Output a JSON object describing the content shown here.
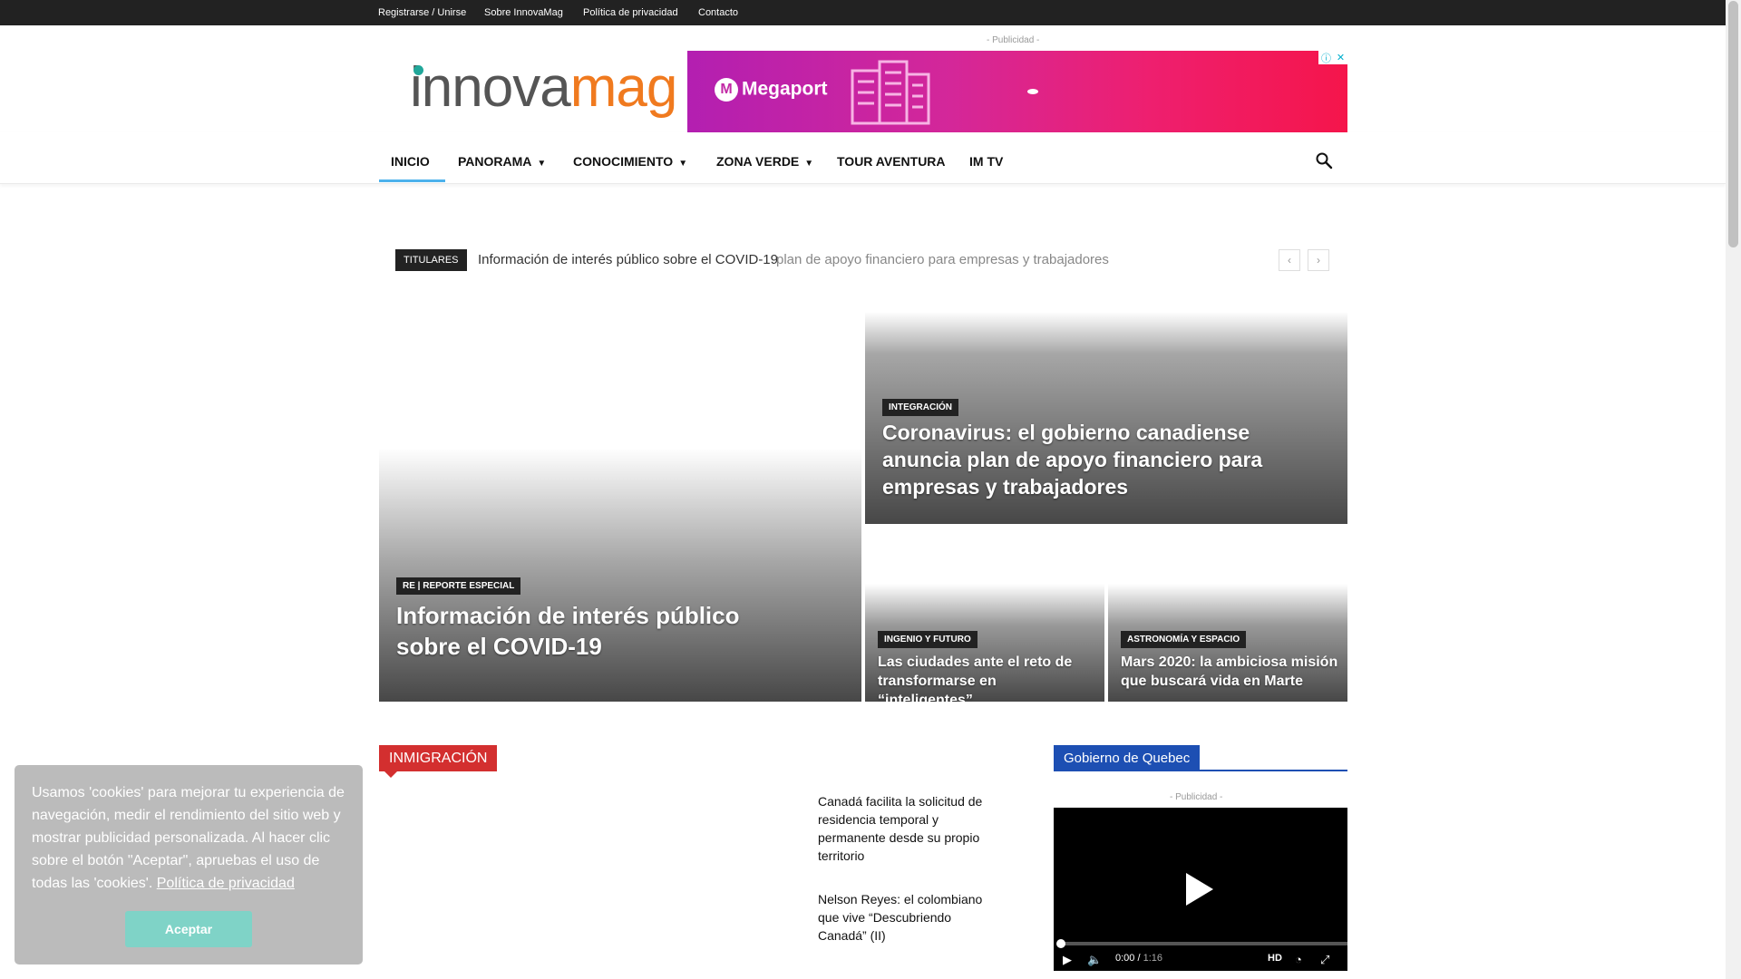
{
  "topbar": {
    "links": [
      "Registrarse / Unirse",
      "Sobre InnovaMag",
      "Política de privacidad",
      "Contacto"
    ]
  },
  "header": {
    "logo_text_a": "innova",
    "logo_text_b": "mag",
    "ad_label": "- Publicidad -",
    "banner_brand": "Megaport"
  },
  "nav": {
    "items": [
      {
        "label": "INICIO",
        "dropdown": false
      },
      {
        "label": "PANORAMA",
        "dropdown": true
      },
      {
        "label": "CONOCIMIENTO",
        "dropdown": true
      },
      {
        "label": "ZONA VERDE",
        "dropdown": true
      },
      {
        "label": "TOUR AVENTURA",
        "dropdown": false
      },
      {
        "label": "IM TV",
        "dropdown": false
      }
    ]
  },
  "ticker": {
    "badge": "TITULARES",
    "current": "Información de interés público sobre el COVID-19",
    "fading": "plan de apoyo financiero para empresas y trabajadores",
    "prev": "‹",
    "next": "›"
  },
  "hero": {
    "main": {
      "category": "RE | REPORTE ESPECIAL",
      "title": "Información de interés público sobre el COVID-19"
    },
    "top_right": {
      "category": "INTEGRACIÓN",
      "title": "Coronavirus: el gobierno canadiense anuncia plan de apoyo financiero para empresas y trabajadores"
    },
    "bottom_left": {
      "category": "INGENIO Y FUTURO",
      "title": "Las ciudades ante el reto de transformarse en “inteligentes”"
    },
    "bottom_right": {
      "category": "ASTRONOMÍA Y ESPACIO",
      "title": "Mars 2020: la ambiciosa misión que buscará vida en Marte"
    }
  },
  "inmigracion": {
    "heading": "INMIGRACIÓN",
    "accent": "#d32f2f",
    "articles": [
      "Canadá facilita la solicitud de residencia temporal y permanente desde su propio territorio",
      "Nelson Reyes: el colombiano que vive “Descubriendo Canadá” (II)"
    ]
  },
  "sidebar": {
    "heading": "Gobierno de Quebec",
    "accent": "#1d4fb3",
    "ad_label": "- Publicidad -",
    "video": {
      "time_current": "0:00",
      "time_total": "1:16",
      "quality": "HD"
    }
  },
  "cookie": {
    "text": "Usamos 'cookies' para mejorar tu experiencia de navegación, medir el rendimiento del sitio web y mostrar publicidad personalizada. Al hacer clic sobre el botón \"Aceptar\", apruebas el uso de todas las 'cookies'.",
    "policy_link": "Política de privacidad",
    "accept_label": "Aceptar"
  },
  "icons": [
    "search-icon",
    "chevron-down-icon",
    "adchoices-icon",
    "close-icon",
    "play-icon",
    "mute-icon",
    "speed-icon",
    "fullscreen-icon"
  ]
}
